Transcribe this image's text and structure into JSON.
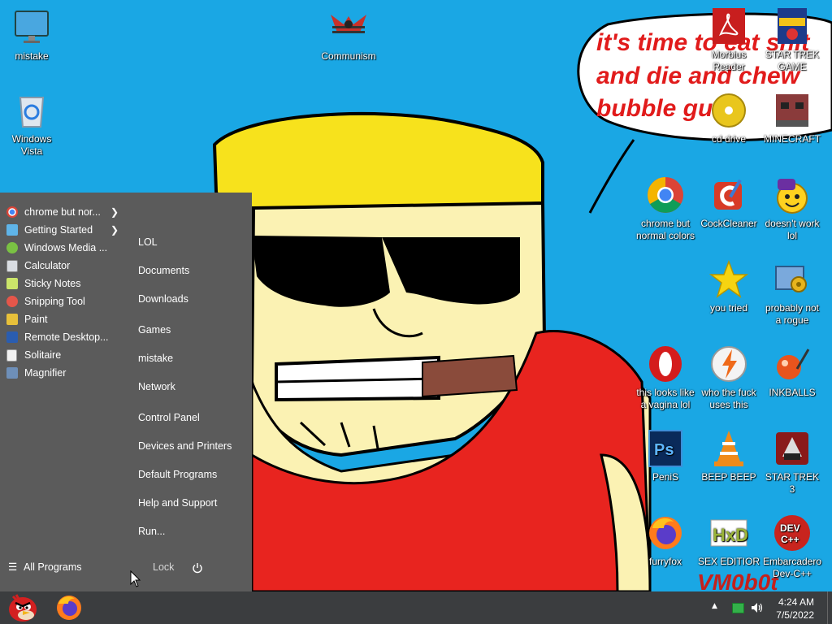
{
  "speech": {
    "line1": "it's time to eat shit",
    "line2": "and die and chew",
    "line3": "bubble gum"
  },
  "watermark": "VM0b0t",
  "desktop_icons": [
    {
      "label": "mistake"
    },
    {
      "label": "Windows Vista"
    },
    {
      "label": "Communism"
    },
    {
      "label": "Morbius Reader"
    },
    {
      "label": "STAR TREK GAME"
    },
    {
      "label": "cd drive"
    },
    {
      "label": "MINECRAFT"
    },
    {
      "label": "chrome but normal colors"
    },
    {
      "label": "CockCleaner"
    },
    {
      "label": "doesn't work lol"
    },
    {
      "label": "you tried"
    },
    {
      "label": "probably not a rogue"
    },
    {
      "label": "this looks like a vagina lol"
    },
    {
      "label": "who the fuck uses this"
    },
    {
      "label": "INKBALLS"
    },
    {
      "label": "PeniS"
    },
    {
      "label": "BEEP BEEP"
    },
    {
      "label": "STAR TREK 3"
    },
    {
      "label": "furryfox"
    },
    {
      "label": "SEX EDITIOR"
    },
    {
      "label": "Embarcadero Dev-C++"
    }
  ],
  "start_menu": {
    "programs": [
      {
        "label": "chrome but nor...",
        "icon": "chrome-icon",
        "has_submenu": true
      },
      {
        "label": "Getting Started",
        "icon": "getting-started-icon",
        "has_submenu": true
      },
      {
        "label": "Windows Media ...",
        "icon": "media-player-icon",
        "has_submenu": false
      },
      {
        "label": "Calculator",
        "icon": "calculator-icon",
        "has_submenu": false
      },
      {
        "label": "Sticky Notes",
        "icon": "sticky-notes-icon",
        "has_submenu": false
      },
      {
        "label": "Snipping Tool",
        "icon": "snipping-tool-icon",
        "has_submenu": false
      },
      {
        "label": "Paint",
        "icon": "paint-icon",
        "has_submenu": false
      },
      {
        "label": "Remote Desktop...",
        "icon": "remote-desktop-icon",
        "has_submenu": false
      },
      {
        "label": "Solitaire",
        "icon": "solitaire-icon",
        "has_submenu": false
      },
      {
        "label": "Magnifier",
        "icon": "magnifier-icon",
        "has_submenu": false
      }
    ],
    "places": [
      "LOL",
      "Documents",
      "Downloads",
      "Games",
      "mistake",
      "Network",
      "Control Panel",
      "Devices and Printers",
      "Default Programs",
      "Help and Support",
      "Run..."
    ],
    "all_programs": "All Programs",
    "lock": "Lock"
  },
  "tray": {
    "time": "4:24 AM",
    "date": "7/5/2022"
  }
}
